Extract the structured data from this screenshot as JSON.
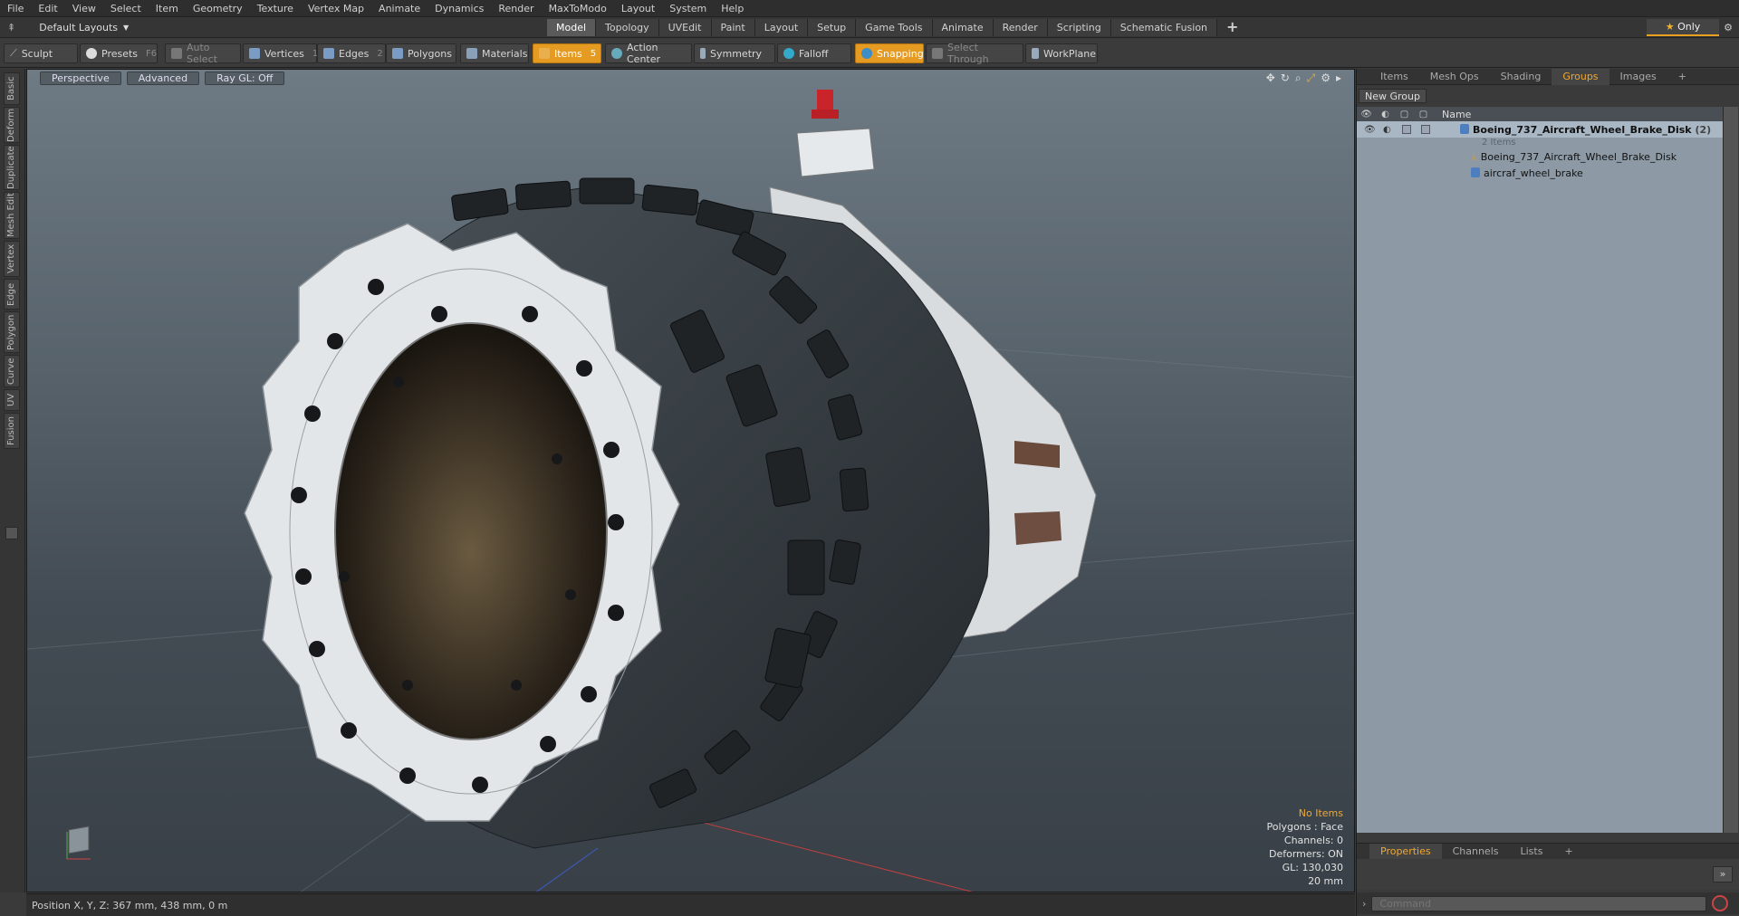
{
  "menu": [
    "File",
    "Edit",
    "View",
    "Select",
    "Item",
    "Geometry",
    "Texture",
    "Vertex Map",
    "Animate",
    "Dynamics",
    "Render",
    "MaxToModo",
    "Layout",
    "System",
    "Help"
  ],
  "layout_selector": "Default Layouts",
  "mode_tabs": [
    {
      "label": "Model",
      "active": true
    },
    {
      "label": "Topology"
    },
    {
      "label": "UVEdit"
    },
    {
      "label": "Paint"
    },
    {
      "label": "Layout"
    },
    {
      "label": "Setup"
    },
    {
      "label": "Game Tools"
    },
    {
      "label": "Animate"
    },
    {
      "label": "Render"
    },
    {
      "label": "Scripting"
    },
    {
      "label": "Schematic Fusion"
    }
  ],
  "only_label": "Only",
  "toolbar": {
    "sculpt": "Sculpt",
    "presets": "Presets",
    "presets_key": "F6",
    "auto_select": "Auto Select",
    "vertices": "Vertices",
    "vertices_key": "1",
    "edges": "Edges",
    "edges_key": "2",
    "polygons": "Polygons",
    "materials": "Materials",
    "items": "Items",
    "items_key": "5",
    "action_center": "Action Center",
    "symmetry": "Symmetry",
    "falloff": "Falloff",
    "snapping": "Snapping",
    "select_through": "Select Through",
    "workplane": "WorkPlane"
  },
  "left_tabs": [
    "Basic",
    "Deform",
    "Duplicate",
    "Mesh Edit",
    "Vertex",
    "Edge",
    "Polygon",
    "Curve",
    "UV",
    "Fusion"
  ],
  "viewport": {
    "view": "Perspective",
    "shading": "Advanced",
    "raygl": "Ray GL: Off",
    "info": {
      "items": "No Items",
      "polygons": "Polygons : Face",
      "channels": "Channels: 0",
      "deformers": "Deformers: ON",
      "gl": "GL: 130,030",
      "grid": "20 mm"
    }
  },
  "status_bar": "Position X, Y, Z:  367 mm, 438 mm, 0 m",
  "right_panel": {
    "tabs": [
      {
        "label": "Items"
      },
      {
        "label": "Mesh Ops"
      },
      {
        "label": "Shading"
      },
      {
        "label": "Groups",
        "active": true
      },
      {
        "label": "Images"
      }
    ],
    "new_group": "New Group",
    "column_name": "Name",
    "tree": {
      "group_name": "Boeing_737_Aircraft_Wheel_Brake_Disk",
      "group_count": "(2)",
      "group_items": "2 Items",
      "child1": "Boeing_737_Aircraft_Wheel_Brake_Disk",
      "child2": "aircraf_wheel_brake"
    },
    "bottom_tabs": [
      {
        "label": "Properties",
        "active": true
      },
      {
        "label": "Channels"
      },
      {
        "label": "Lists"
      }
    ],
    "command_placeholder": "Command"
  },
  "colors": {
    "accent": "#e59b21",
    "tree_bg": "#8d9aa6"
  }
}
